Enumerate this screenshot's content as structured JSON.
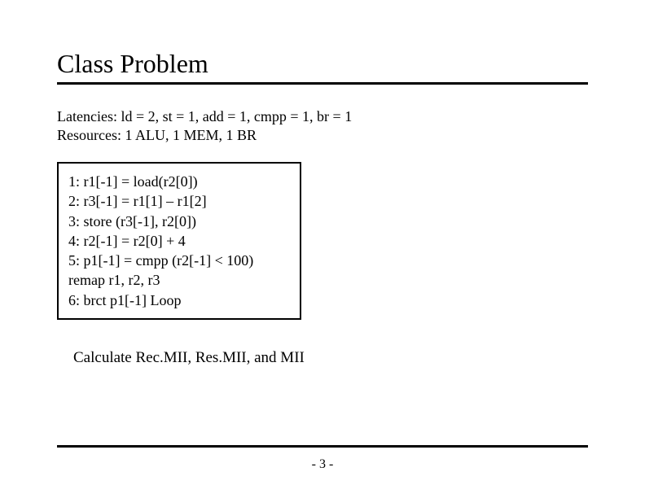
{
  "title": "Class Problem",
  "latencies": "Latencies: ld = 2, st = 1, add = 1, cmpp = 1, br = 1",
  "resources": "Resources: 1 ALU, 1 MEM, 1 BR",
  "code": {
    "l1": "1: r1[-1] = load(r2[0])",
    "l2": "2: r3[-1] = r1[1] – r1[2]",
    "l3": "3: store (r3[-1], r2[0])",
    "l4": "4: r2[-1] = r2[0] + 4",
    "l5": "5: p1[-1] = cmpp (r2[-1] < 100)",
    "l6": "remap r1, r2, r3",
    "l7": "6: brct p1[-1] Loop"
  },
  "prompt": "Calculate Rec.MII, Res.MII, and MII",
  "page": "- 3 -"
}
